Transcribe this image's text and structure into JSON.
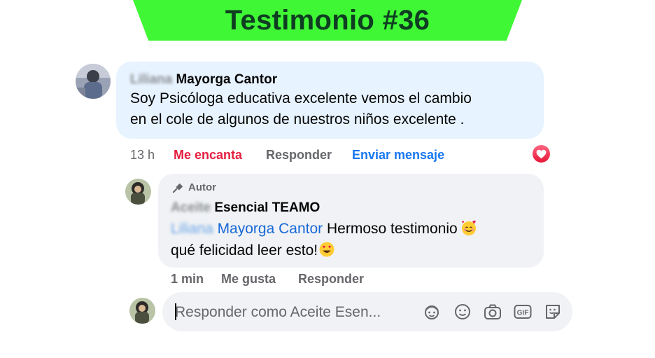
{
  "banner": {
    "title": "Testimonio #36"
  },
  "comment": {
    "author_first": "Liliana",
    "author_last": "Mayorga Cantor",
    "lines": [
      "Soy Psicóloga educativa excelente vemos el cambio",
      "en el cole de algunos de nuestros niños excelente ."
    ],
    "time": "13 h",
    "reaction_given": "Me encanta",
    "reply_label": "Responder",
    "send_message_label": "Enviar mensaje",
    "reaction_badge_icon": "heart-icon"
  },
  "reply": {
    "author_badge": "Autor",
    "author_first": "Aceite",
    "author_last": "Esencial TEAMO",
    "mention_first": "Liliana",
    "mention_last": "Mayorga Cantor",
    "line1_rest": "Hermoso testimonio",
    "line2": "qué felicidad leer esto!",
    "time": "1 min",
    "like_label": "Me gusta",
    "reply_label": "Responder"
  },
  "composer": {
    "placeholder": "Responder como Aceite Esen...",
    "icons": [
      "avatar-sticker-icon",
      "emoji-icon",
      "camera-icon",
      "gif-icon",
      "sticker-icon"
    ]
  },
  "colors": {
    "banner": "#3ff734",
    "banner_text": "#0f3d22",
    "love": "#e41e3f",
    "link": "#1877f2",
    "comment_bubble": "#e7f3ff",
    "reply_bubble": "#f0f2f5"
  }
}
